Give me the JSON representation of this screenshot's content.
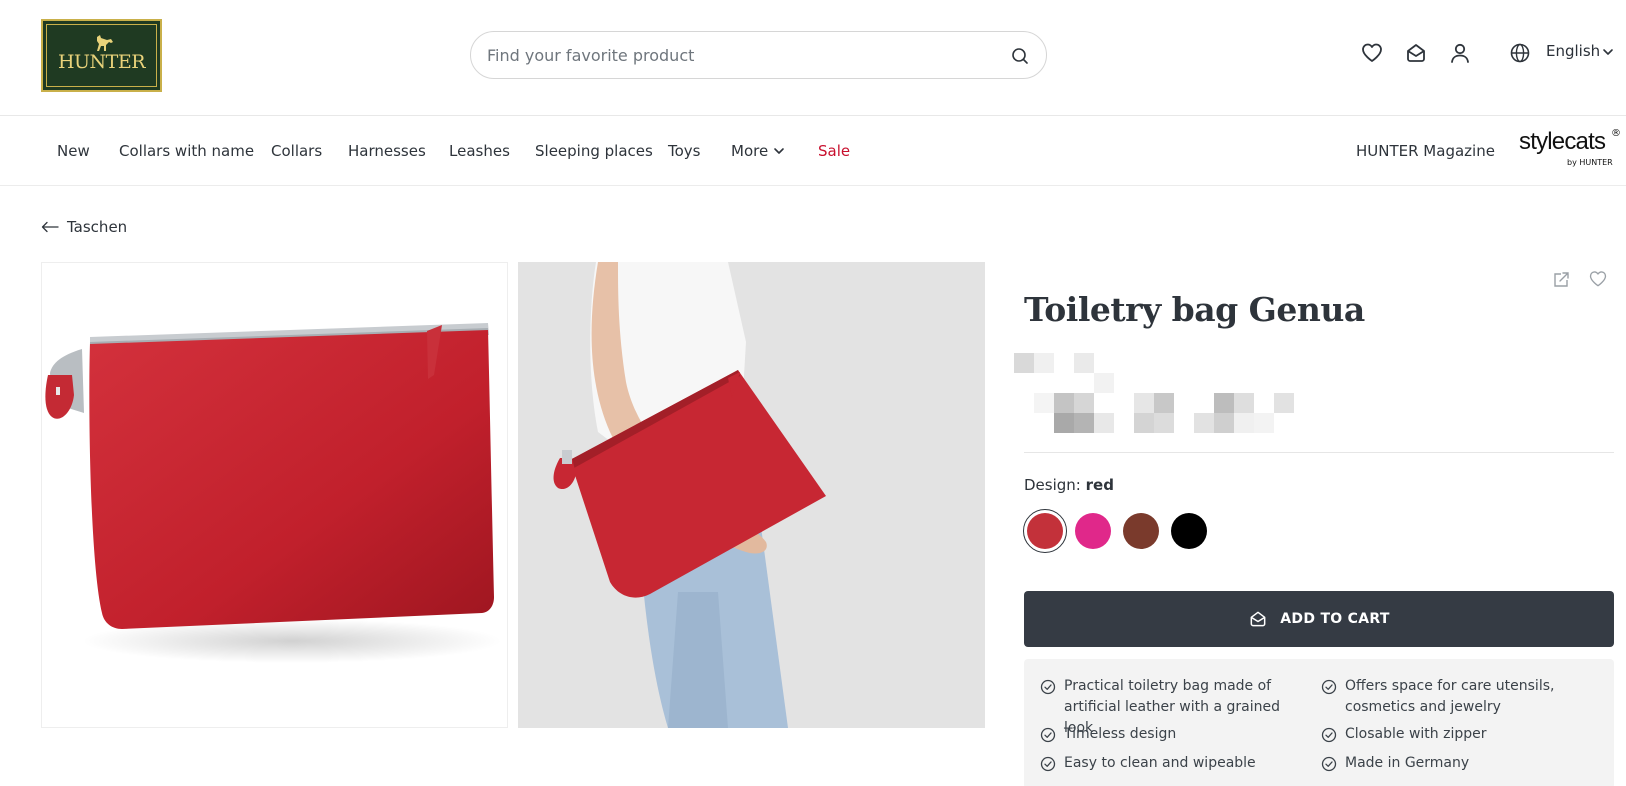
{
  "header": {
    "logo_text": "HUNTER",
    "search_placeholder": "Find your favorite product",
    "icons": [
      "search-icon",
      "heart-icon",
      "cart-icon",
      "user-icon",
      "globe-icon"
    ],
    "language": "English"
  },
  "nav": {
    "items": [
      "New",
      "Collars with name",
      "Collars",
      "Harnesses",
      "Leashes",
      "Sleeping places",
      "Toys",
      "More",
      "Sale"
    ],
    "magazine": "HUNTER Magazine",
    "partner_logo": "stylecats",
    "partner_sub": "by HUNTER",
    "registered": "®"
  },
  "breadcrumb": {
    "back_label": "Taschen"
  },
  "product": {
    "title": "Toiletry bag Genua",
    "design_label": "Design:",
    "design_value": "red",
    "swatches": [
      {
        "name": "red",
        "color": "#c3313a",
        "selected": true
      },
      {
        "name": "pink",
        "color": "#e0288a",
        "selected": false
      },
      {
        "name": "brown",
        "color": "#7a3a2c",
        "selected": false
      },
      {
        "name": "black",
        "color": "#000000",
        "selected": false
      }
    ],
    "add_to_cart": "ADD TO CART",
    "features": [
      "Practical toiletry bag made of artificial leather with a grained look",
      "Offers space for care utensils, cosmetics and jewelry",
      "Timeless design",
      "Closable with zipper",
      "Easy to clean and wipeable",
      "Made in Germany"
    ]
  },
  "colors": {
    "accent_dark": "#353b44",
    "sale_red": "#c8102e",
    "logo_green": "#1f3a22",
    "logo_gold": "#c9b04a"
  }
}
